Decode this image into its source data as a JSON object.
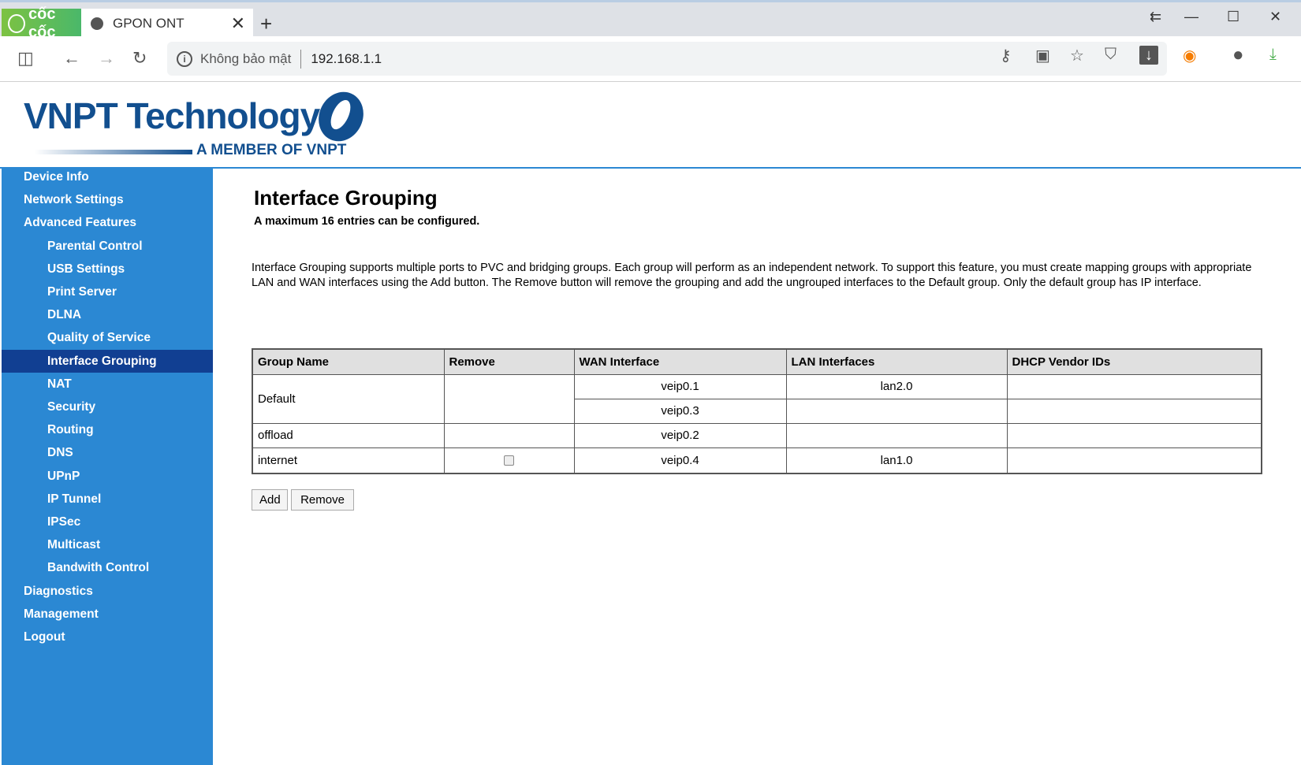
{
  "browser": {
    "brand": "cốc cốc",
    "tab_title": "GPON ONT",
    "security_label": "Không bảo mật",
    "url": "192.168.1.1"
  },
  "header": {
    "brand": "VNPT Technology",
    "tagline": "A MEMBER OF VNPT"
  },
  "sidebar": {
    "items": [
      {
        "label": "Device Info",
        "level": 0
      },
      {
        "label": "Network Settings",
        "level": 0
      },
      {
        "label": "Advanced Features",
        "level": 0
      },
      {
        "label": "Parental Control",
        "level": 1
      },
      {
        "label": "USB Settings",
        "level": 1
      },
      {
        "label": "Print Server",
        "level": 1
      },
      {
        "label": "DLNA",
        "level": 1
      },
      {
        "label": "Quality of Service",
        "level": 1
      },
      {
        "label": "Interface Grouping",
        "level": 1,
        "active": true
      },
      {
        "label": "NAT",
        "level": 1
      },
      {
        "label": "Security",
        "level": 1
      },
      {
        "label": "Routing",
        "level": 1
      },
      {
        "label": "DNS",
        "level": 1
      },
      {
        "label": "UPnP",
        "level": 1
      },
      {
        "label": "IP Tunnel",
        "level": 1
      },
      {
        "label": "IPSec",
        "level": 1
      },
      {
        "label": "Multicast",
        "level": 1
      },
      {
        "label": "Bandwith Control",
        "level": 1
      },
      {
        "label": "Diagnostics",
        "level": 0
      },
      {
        "label": "Management",
        "level": 0
      },
      {
        "label": "Logout",
        "level": 0
      }
    ]
  },
  "main": {
    "title": "Interface Grouping",
    "subtitle": "A maximum 16 entries can be configured.",
    "description": "Interface Grouping supports multiple ports to PVC and bridging groups. Each group will perform as an independent network. To support this feature, you must create mapping groups with appropriate LAN and WAN interfaces using the Add button. The Remove button will remove the grouping and add the ungrouped interfaces to the Default group. Only the default group has IP interface.",
    "table": {
      "headers": [
        "Group Name",
        "Remove",
        "WAN Interface",
        "LAN Interfaces",
        "DHCP Vendor IDs"
      ],
      "rows": [
        {
          "group": "Default",
          "wan": "veip0.1",
          "lan": "lan2.0",
          "dhcp": ""
        },
        {
          "group": "",
          "wan": "veip0.3",
          "lan": "",
          "dhcp": ""
        },
        {
          "group": "offload",
          "wan": "veip0.2",
          "lan": "",
          "dhcp": ""
        },
        {
          "group": "internet",
          "remove_checked": false,
          "wan": "veip0.4",
          "lan": "lan1.0",
          "dhcp": ""
        }
      ]
    },
    "add_label": "Add",
    "remove_label": "Remove"
  }
}
